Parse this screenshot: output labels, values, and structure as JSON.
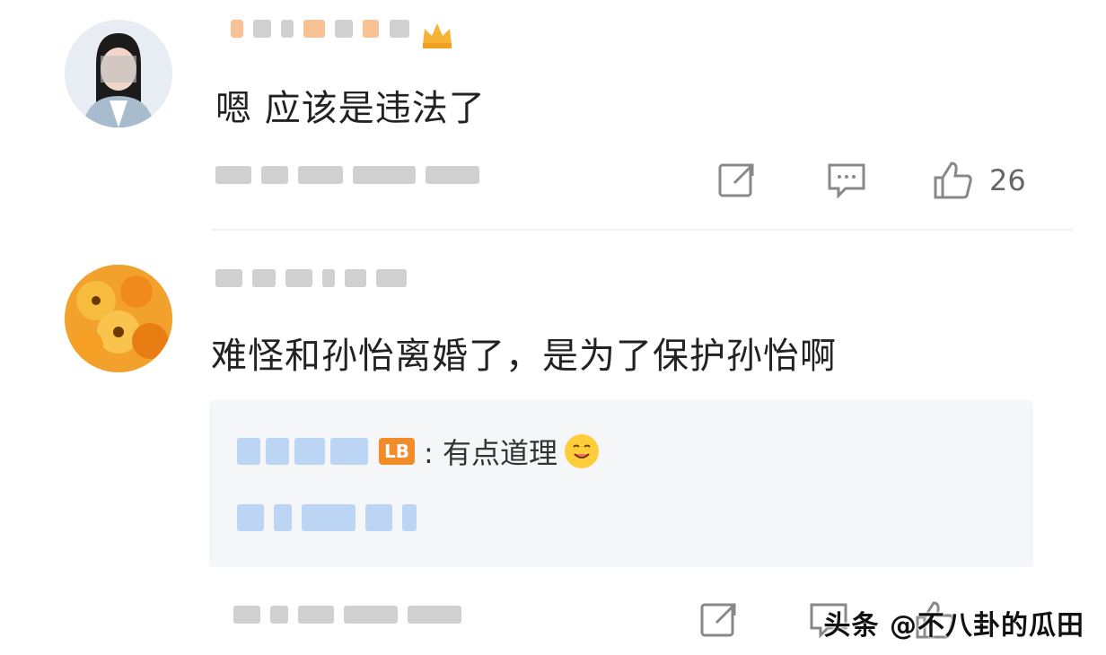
{
  "comments": [
    {
      "text": "嗯 应该是违法了",
      "likes": "26",
      "icons": [
        "share-icon",
        "comment-icon",
        "like-icon"
      ]
    },
    {
      "text": "难怪和孙怡离婚了，是为了保护孙怡啊",
      "reply": {
        "text": ": 有点道理",
        "badge_text": "LB"
      },
      "icons": [
        "share-icon",
        "comment-icon",
        "like-icon"
      ]
    }
  ],
  "watermark": "头条 @不八卦的瓜田",
  "colors": {
    "background": "#ffffff",
    "reply_background": "#f5f6f8",
    "text": "#222222",
    "muted": "#666666",
    "badge": "#f28b2a"
  }
}
